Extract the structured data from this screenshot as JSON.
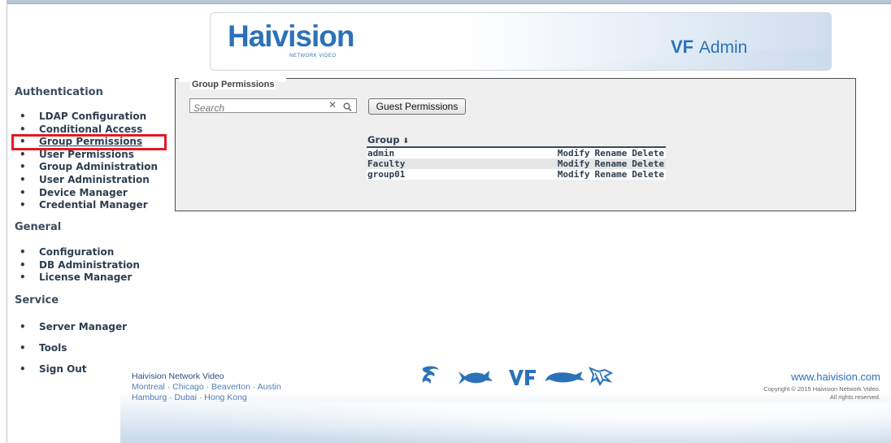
{
  "header": {
    "logo_text": "Haivision",
    "logo_subtext": "NETWORK VIDEO",
    "product_mark": "VF",
    "product_name": "Admin"
  },
  "sidebar": {
    "sections": [
      {
        "heading": "Authentication",
        "items": [
          {
            "label": "LDAP Configuration"
          },
          {
            "label": "Conditional Access"
          },
          {
            "label": "Group Permissions",
            "active": true
          },
          {
            "label": "User Permissions"
          },
          {
            "label": "Group Administration"
          },
          {
            "label": "User Administration"
          },
          {
            "label": "Device Manager"
          },
          {
            "label": "Credential Manager"
          }
        ]
      },
      {
        "heading": "General",
        "items": [
          {
            "label": "Configuration"
          },
          {
            "label": "DB Administration"
          },
          {
            "label": "License Manager"
          }
        ]
      },
      {
        "heading": "Service",
        "items": [
          {
            "label": "Server Manager"
          },
          {
            "label": "Tools"
          },
          {
            "label": "Sign Out"
          }
        ]
      }
    ],
    "highlight_color": "#e01b24"
  },
  "panel": {
    "legend": "Group Permissions",
    "search_placeholder": "Search",
    "search_clear": "✕",
    "guest_button": "Guest Permissions",
    "column_header": "Group",
    "sort_indicator": "⬇",
    "rows": [
      {
        "name": "admin",
        "actions": [
          "Modify",
          "Rename",
          "Delete"
        ]
      },
      {
        "name": "Faculty",
        "actions": [
          "Modify",
          "Rename",
          "Delete"
        ]
      },
      {
        "name": "group01",
        "actions": [
          "Modify",
          "Rename",
          "Delete"
        ]
      }
    ]
  },
  "footer": {
    "company": "Haivision Network Video",
    "cities_line1": "Montreal · Chicago · Beaverton · Austin",
    "cities_line2": "Hamburg · Dubai · Hong Kong",
    "url": "www.haivision.com",
    "copyright_line1": "Copyright © 2015 Haivision Network Video.",
    "copyright_line2": "All rights reserved.",
    "product_icons": [
      "kraken-icon",
      "shark-icon",
      "vf-icon",
      "barracuda-icon",
      "skeleton-fish-icon"
    ]
  },
  "colors": {
    "brand_blue": "#2b72b8",
    "nav_text": "#2d3e50",
    "panel_bg": "#efefef"
  }
}
